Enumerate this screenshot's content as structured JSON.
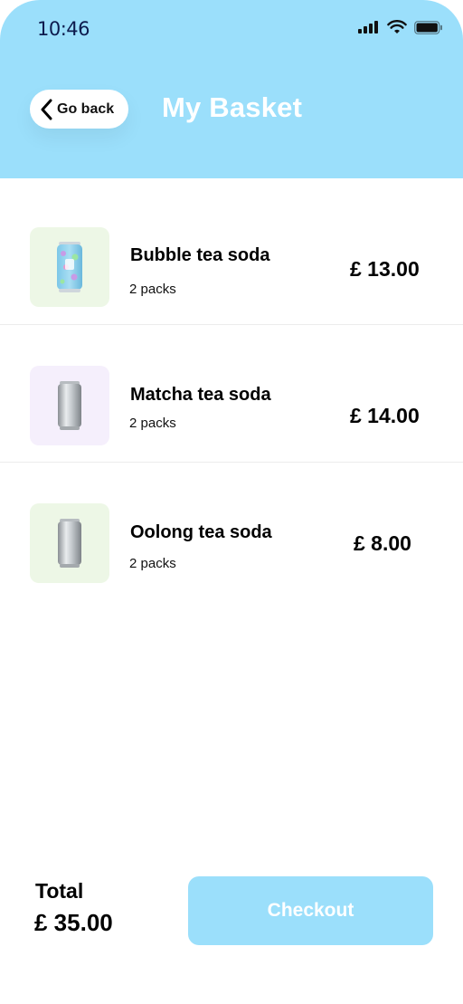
{
  "status_bar": {
    "time": "10:46"
  },
  "header": {
    "back_label": "Go back",
    "title": "My Basket",
    "bg_color": "#9bdffb"
  },
  "items": [
    {
      "name": "Bubble tea soda",
      "quantity": "2 packs",
      "price": "£ 13.00",
      "thumb_color": "#edf7e6",
      "icon": "bubble-tea-can-icon"
    },
    {
      "name": "Matcha tea soda",
      "quantity": "2 packs",
      "price": "£ 14.00",
      "thumb_color": "#f5effc",
      "icon": "silver-can-icon"
    },
    {
      "name": "Oolong tea soda",
      "quantity": "2 packs",
      "price": "£ 8.00",
      "thumb_color": "#edf7e6",
      "icon": "silver-can-icon"
    }
  ],
  "footer": {
    "total_label": "Total",
    "total_value": "£ 35.00",
    "checkout_label": "Checkout",
    "checkout_color": "#9bdffb"
  }
}
